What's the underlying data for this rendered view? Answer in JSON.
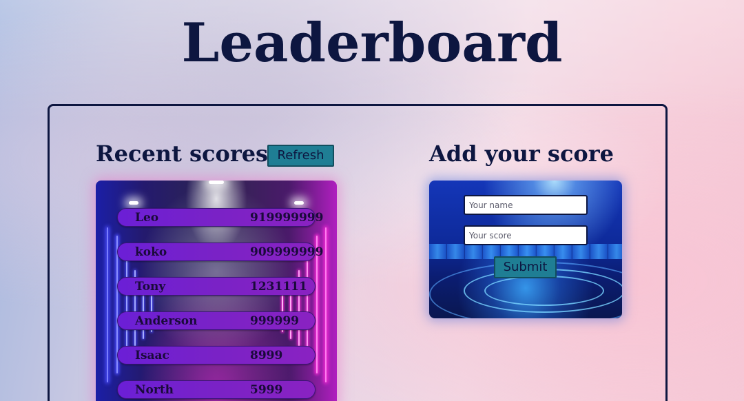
{
  "page": {
    "title": "Leaderboard"
  },
  "recent": {
    "heading": "Recent scores",
    "refresh_label": "Refresh",
    "scores": [
      {
        "name": "Leo",
        "score": "919999999"
      },
      {
        "name": "koko",
        "score": "909999999"
      },
      {
        "name": "Tony",
        "score": "1231111"
      },
      {
        "name": "Anderson",
        "score": "999999"
      },
      {
        "name": "Isaac",
        "score": "8999"
      },
      {
        "name": "North",
        "score": "5999"
      }
    ]
  },
  "add": {
    "heading": "Add your score",
    "name_placeholder": "Your name",
    "score_placeholder": "Your score",
    "submit_label": "Submit"
  },
  "colors": {
    "heading_text": "#0d1640",
    "button_bg": "#1f7e94",
    "row_bg": "#7a22c6"
  }
}
